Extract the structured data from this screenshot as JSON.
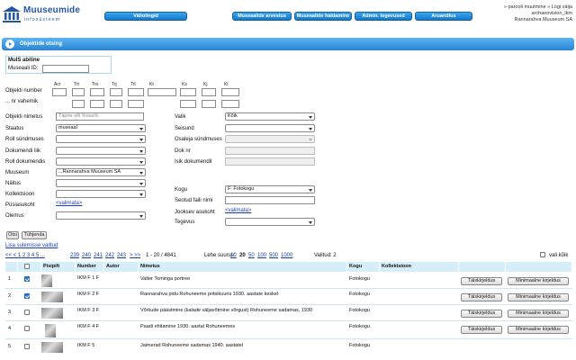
{
  "header": {
    "logo_title": "Muuseumide",
    "logo_subtitle": "infosüsteem",
    "nav": [
      "Väliolingid",
      "Museaalide arvestus",
      "Museaalide haldamine",
      "Admin. tegevused",
      "Aruandlus"
    ],
    "links_line1": "» parooli muutmine  » Logi välja",
    "user_line2": "archaeovision_ikm",
    "user_line3": "Rannarahva Muuseum SA",
    "brand_color": "#2456a8",
    "nav_color": "#1678c8"
  },
  "section": {
    "title": "Objektide otsing"
  },
  "museum_box": {
    "title": "MuIS abiline",
    "id_label": "Museaali ID:"
  },
  "number_grid": {
    "label1": "Objekti number",
    "label2": "... nr vahemik",
    "heads": [
      "Acr",
      "Trt",
      "Trs",
      "Trj",
      "Trl",
      "Kt",
      "Ks",
      "Kj",
      "Kl"
    ]
  },
  "left_form": {
    "name_label": "Objekti nimetus",
    "name_placeholder": "Täpne või %osa%",
    "status_label": "Staatus",
    "status_value": "museaal",
    "role_event_label": "Roll sündmuses",
    "doc_type_label": "Dokumendi liik",
    "role_doc_label": "Roll dokumendis",
    "museum_label": "Muuseum",
    "museum_value": "...Rannarahva Muuseum SA",
    "exhibit_label": "Näitus",
    "collection_label": "Kollektsioon",
    "location_label": "Püsiasukoht",
    "location_link": "<valimata>",
    "condition_label": "Olemus"
  },
  "right_form": {
    "choice_label": "Valik",
    "choice_value": "Kõik",
    "state_label": "Seisund",
    "participant_label": "Osaleja sündmuses",
    "doc_nr_label": "Dok nr",
    "person_doc_label": "Isik dokumendil",
    "collection_label": "Kogu",
    "collection_value": "F: Fotokogu",
    "file_name_label": "Seotud faili nimi",
    "current_location_label": "Jooksev asukoht",
    "current_location_link": "<valimata>",
    "activity_label": "Tegevus"
  },
  "buttons": {
    "search": "Otsi",
    "clear": "Tühjenda"
  },
  "more_link": "Lisa sulemisse valitud",
  "pager": {
    "prev": "<< < 1 2 3 4 5 ...",
    "pages": [
      "239",
      "240",
      "241",
      "242",
      "243"
    ],
    "next": "> >>",
    "range": "1 - 20 / 4841",
    "page_size_label": "Lehe suurus:",
    "sizes": [
      "10",
      "20",
      "50",
      "100",
      "500",
      "1000"
    ],
    "selected_label": "Valitud: 2",
    "select_all_label": "vali kõik"
  },
  "table": {
    "headers": [
      "",
      "",
      "Pisipilt",
      "Number",
      "Autor",
      "Nimetus",
      "Kogu",
      "Kollektsioon",
      "",
      ""
    ],
    "rows": [
      {
        "n": "1",
        "checked": true,
        "number": "IKM F 1 F",
        "author": "",
        "title": "Valter Tominga portree",
        "collection": "Fotokogu"
      },
      {
        "n": "2",
        "checked": true,
        "number": "IKM F 2 F",
        "author": "",
        "title": "Rannarahva pidu Rohuneeme pritsikuuris 1930. aastate keskel",
        "collection": "Fotokogu"
      },
      {
        "n": "3",
        "checked": false,
        "number": "IKM F 3 F",
        "author": "",
        "title": "Võrkude päästmine (kalade väljavõtmine võrgust) Rohuneeme sadamas, 1930",
        "collection": "Fotokogu"
      },
      {
        "n": "4",
        "checked": false,
        "number": "IKM F 4 F",
        "author": "",
        "title": "Paadi ehitamine 1930. aastal Rohuneemes",
        "collection": "Fotokogu"
      },
      {
        "n": "5",
        "checked": false,
        "number": "IKM F 5",
        "author": "",
        "title": "Jaimerad Rohuneeme sadamas 1940. aastatel",
        "collection": "Fotokogu"
      }
    ],
    "full_desc_btn": "Täiskirjeldus",
    "min_desc_btn": "Minimaalne kirjeldus"
  }
}
